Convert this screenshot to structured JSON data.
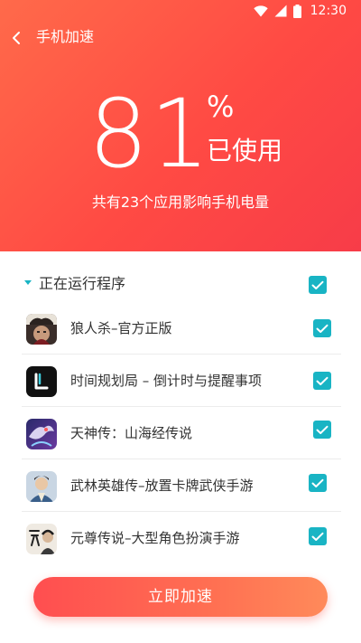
{
  "status_bar": {
    "time": "12:30",
    "icons": [
      "wifi-icon",
      "signal-icon",
      "battery-icon"
    ]
  },
  "header": {
    "back_icon": "chevron-left-icon",
    "title": "手机加速"
  },
  "usage": {
    "value": "81",
    "unit": "%",
    "label": "已使用",
    "description": "共有23个应用影响手机电量"
  },
  "running_section": {
    "title": "正在运行程序",
    "select_all_checked": true
  },
  "apps": [
    {
      "name": "狼人杀–官方正版",
      "icon": "werewolf-game-icon",
      "checked": true
    },
    {
      "name": "时间规划局 – 倒计时与提醒事项",
      "icon": "time-planner-icon",
      "checked": true
    },
    {
      "name": "天神传：山海经传说",
      "icon": "tianshen-game-icon",
      "checked": true
    },
    {
      "name": "武林英雄传–放置卡牌武侠手游",
      "icon": "wulin-game-icon",
      "checked": true
    },
    {
      "name": "元尊传说–大型角色扮演手游",
      "icon": "yuanzun-game-icon",
      "checked": true
    }
  ],
  "action": {
    "label": "立即加速"
  },
  "colors": {
    "header_gradient_start": "#ff6a4a",
    "header_gradient_end": "#f73c48",
    "checkbox": "#19b4c4",
    "button_gradient_start": "#ff4e50",
    "button_gradient_end": "#ff8a5a"
  }
}
